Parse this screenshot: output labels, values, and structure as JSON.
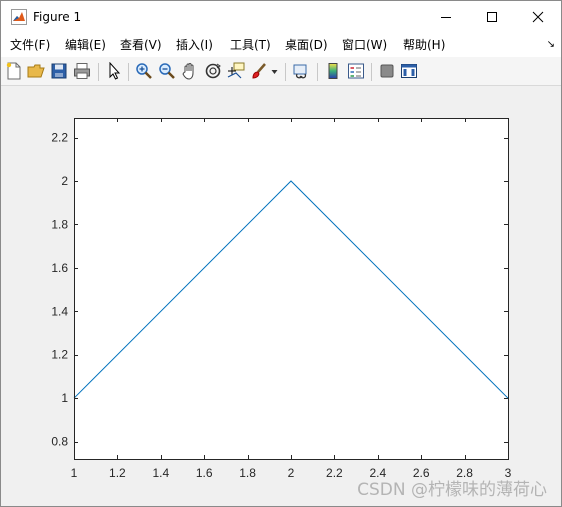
{
  "window": {
    "title": "Figure 1"
  },
  "menu": {
    "items": [
      "文件(F)",
      "编辑(E)",
      "查看(V)",
      "插入(I)",
      "工具(T)",
      "桌面(D)",
      "窗口(W)",
      "帮助(H)"
    ],
    "overflow_glyph": "↘"
  },
  "toolbar": {
    "icons": [
      "new-figure-icon",
      "open-file-icon",
      "save-icon",
      "print-icon",
      "pointer-icon",
      "zoom-in-icon",
      "zoom-out-icon",
      "pan-hand-icon",
      "rotate-3d-icon",
      "data-cursor-icon",
      "brush-icon",
      "brush-dropdown-icon",
      "link-plot-icon",
      "colorbar-icon",
      "legend-icon",
      "hide-plot-tools-icon",
      "show-plot-tools-icon"
    ]
  },
  "colors": {
    "line": "#0072bd",
    "axes_bg": "#ffffff",
    "figure_bg": "#f0f0f0"
  },
  "chart_data": {
    "type": "line",
    "x": [
      1,
      2,
      3
    ],
    "series": [
      {
        "values": [
          1,
          2,
          1
        ]
      }
    ],
    "xlim": [
      1,
      3
    ],
    "ylim": [
      0.72,
      2.29
    ],
    "xticks": [
      1,
      1.2,
      1.4,
      1.6,
      1.8,
      2,
      2.2,
      2.4,
      2.6,
      2.8,
      3
    ],
    "xtick_labels": [
      "1",
      "1.2",
      "1.4",
      "1.6",
      "1.8",
      "2",
      "2.2",
      "2.4",
      "2.6",
      "2.8",
      "3"
    ],
    "yticks": [
      0.8,
      1,
      1.2,
      1.4,
      1.6,
      1.8,
      2,
      2.2
    ],
    "ytick_labels": [
      "0.8",
      "1",
      "1.2",
      "1.4",
      "1.6",
      "1.8",
      "2",
      "2.2"
    ],
    "title": "",
    "xlabel": "",
    "ylabel": "",
    "grid": false
  },
  "watermark": "CSDN @柠檬味的薄荷心"
}
